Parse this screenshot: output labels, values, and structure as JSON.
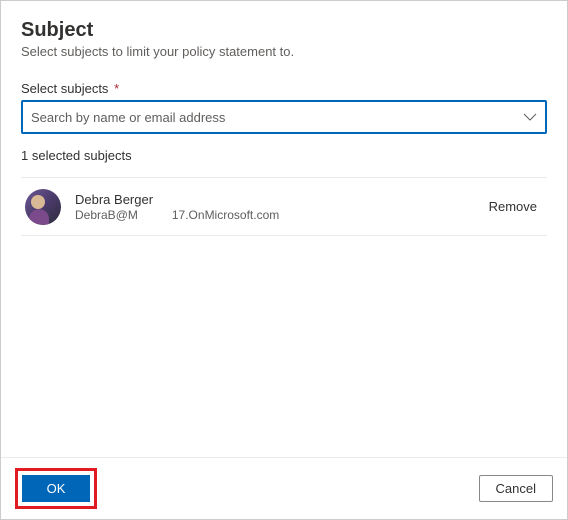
{
  "header": {
    "title": "Subject",
    "subtitle": "Select subjects to limit your policy statement to."
  },
  "form": {
    "search_label": "Select subjects",
    "required_mark": "*",
    "search_placeholder": "Search by name or email address"
  },
  "selected": {
    "count_label": "1 selected subjects",
    "items": [
      {
        "name": "Debra Berger",
        "email_part1": "DebraB@M",
        "email_part2": "17.OnMicrosoft.com",
        "remove_label": "Remove"
      }
    ]
  },
  "footer": {
    "ok_label": "OK",
    "cancel_label": "Cancel"
  }
}
